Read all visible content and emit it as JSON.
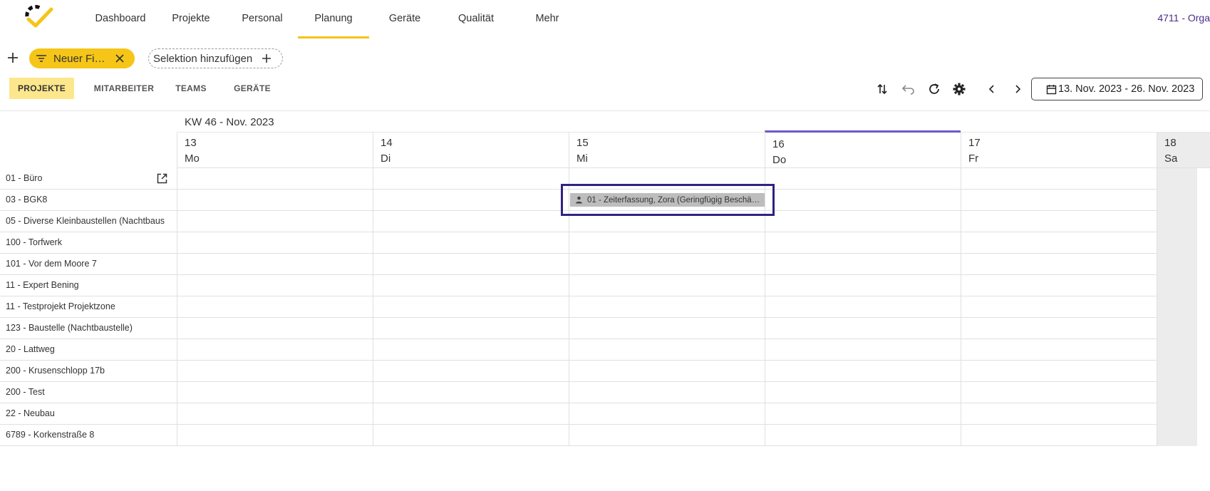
{
  "nav": {
    "logo_icon": "checkmark-logo-icon",
    "items": [
      {
        "label": "Dashboard",
        "active": false
      },
      {
        "label": "Projekte",
        "active": false
      },
      {
        "label": "Personal",
        "active": false
      },
      {
        "label": "Planung",
        "active": true
      },
      {
        "label": "Geräte",
        "active": false
      },
      {
        "label": "Qualität",
        "active": false
      },
      {
        "label": "Mehr",
        "active": false
      }
    ],
    "org": "4711 - Orga"
  },
  "filters": {
    "active_filter": "Neuer Fi…",
    "add_selection": "Selektion hinzufügen"
  },
  "tabs": [
    {
      "label": "PROJEKTE",
      "active": true
    },
    {
      "label": "MITARBEITER",
      "active": false
    },
    {
      "label": "TEAMS",
      "active": false
    },
    {
      "label": "GERÄTE",
      "active": false
    }
  ],
  "toolbar": {
    "icons": [
      "sort-icon",
      "undo-icon",
      "refresh-icon",
      "settings-icon",
      "chevron-left-icon",
      "chevron-right-icon"
    ],
    "date_range": "13. Nov. 2023 - 26. Nov. 2023"
  },
  "calendar": {
    "week_label": "KW 46 - Nov. 2023",
    "days": [
      {
        "num": "13",
        "name": "Mo",
        "today": false,
        "weekend": false
      },
      {
        "num": "14",
        "name": "Di",
        "today": false,
        "weekend": false
      },
      {
        "num": "15",
        "name": "Mi",
        "today": false,
        "weekend": false
      },
      {
        "num": "16",
        "name": "Do",
        "today": true,
        "weekend": false
      },
      {
        "num": "17",
        "name": "Fr",
        "today": false,
        "weekend": false
      },
      {
        "num": "18",
        "name": "Sa",
        "today": false,
        "weekend": true
      }
    ],
    "rows": [
      "01 - Büro",
      "03 - BGK8",
      "05 - Diverse Kleinbaustellen (Nachtbaus",
      "100 - Torfwerk",
      "101 - Vor dem Moore 7",
      "11 - Expert Bening",
      "11 - Testprojekt Projektzone",
      "123 - Baustelle (Nachtbaustelle)",
      "20 - Lattweg",
      "200 - Krusenschlopp 17b",
      "200 - Test",
      "22 - Neubau",
      "6789 - Korkenstraße 8"
    ],
    "event": {
      "text": "01 - Zeiterfassung, Zora (Geringfügig Beschä…",
      "row": "03 - BGK8",
      "day": "15"
    }
  },
  "colors": {
    "accent": "#f5c518",
    "today_marker": "#6a5acd",
    "selection": "#2e2480"
  }
}
